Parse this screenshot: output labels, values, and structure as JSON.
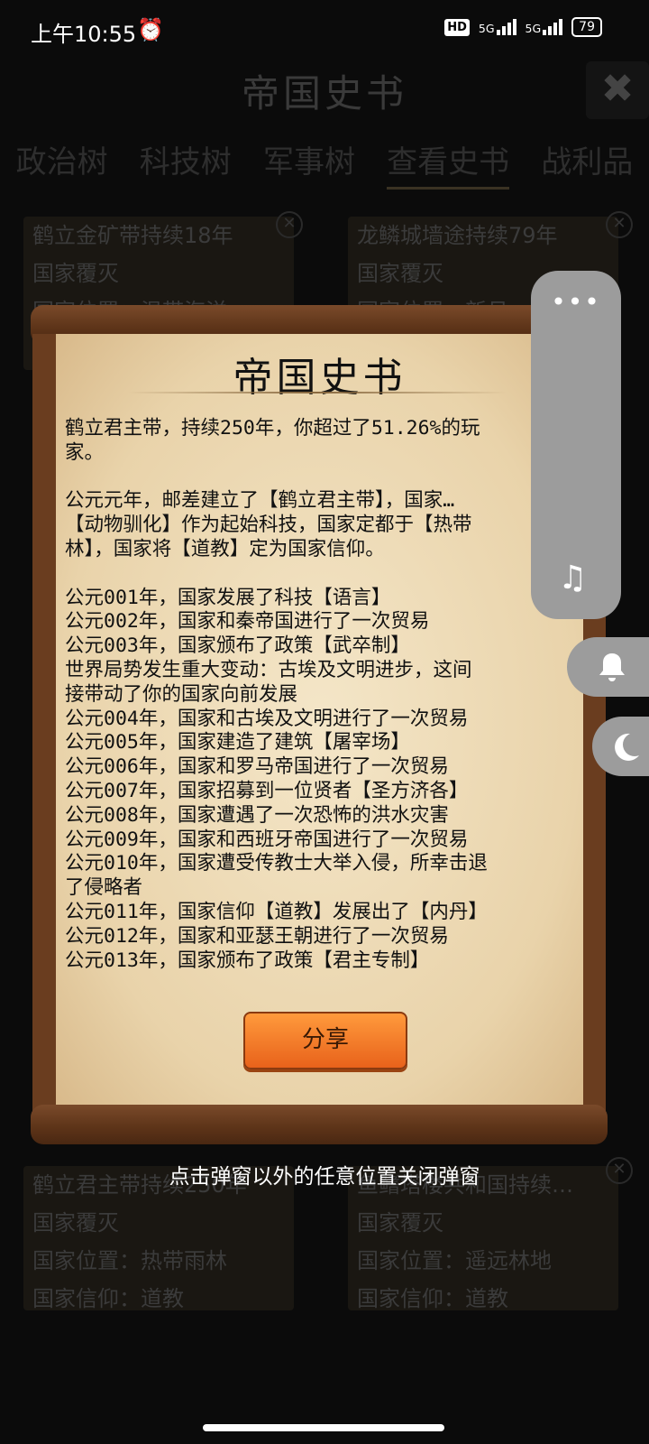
{
  "status_bar": {
    "time": "上午10:55",
    "network_label": "5G",
    "battery": "79"
  },
  "background_screen": {
    "title": "帝国史书",
    "tabs": [
      {
        "label": "政治树"
      },
      {
        "label": "科技树"
      },
      {
        "label": "军事树"
      },
      {
        "label": "查看史书",
        "active": true
      },
      {
        "label": "战利品"
      }
    ],
    "cards": [
      {
        "lines": [
          "鹤立金矿带持续18年",
          "国家覆灭",
          "国家位置：温带海洋"
        ]
      },
      {
        "lines": [
          "龙鳞城墙途持续79年",
          "国家覆灭",
          "国家位置：新月"
        ]
      },
      {
        "lines": [
          "鹤立君主带持续250年",
          "国家覆灭",
          "国家位置：热带雨林",
          "国家信仰：道教"
        ]
      },
      {
        "lines": [
          "鱼鳍塔楼共和国持续…",
          "国家覆灭",
          "国家位置：遥远林地",
          "国家信仰：道教"
        ]
      }
    ]
  },
  "modal": {
    "title": "帝国史书",
    "log_lines": [
      "鹤立君主带，持续250年，你超过了51.26%的玩",
      "家。",
      "",
      "公元元年，邮差建立了【鹤立君主带】，国家…",
      "【动物驯化】作为起始科技，国家定都于【热带",
      "林】，国家将【道教】定为国家信仰。",
      "",
      "公元001年，国家发展了科技【语言】",
      "公元002年，国家和秦帝国进行了一次贸易",
      "公元003年，国家颁布了政策【武卒制】",
      "世界局势发生重大变动：古埃及文明进步，这间",
      "接带动了你的国家向前发展",
      "公元004年，国家和古埃及文明进行了一次贸易",
      "公元005年，国家建造了建筑【屠宰场】",
      "公元006年，国家和罗马帝国进行了一次贸易",
      "公元007年，国家招募到一位贤者【圣方济各】",
      "公元008年，国家遭遇了一次恐怖的洪水灾害",
      "公元009年，国家和西班牙帝国进行了一次贸易",
      "公元010年，国家遭受传教士大举入侵，所幸击退",
      "了侵略者",
      "公元011年，国家信仰【道教】发展出了【内丹】",
      "公元012年，国家和亚瑟王朝进行了一次贸易",
      "公元013年，国家颁布了政策【君主专制】"
    ],
    "share_button": "分享",
    "close_hint": "点击弹窗以外的任意位置关闭弹窗"
  },
  "side_panel": {
    "more_icon": "more-dots-icon",
    "music_icon": "music-off-icon",
    "bell_icon": "bell-icon",
    "moon_icon": "moon-icon"
  }
}
